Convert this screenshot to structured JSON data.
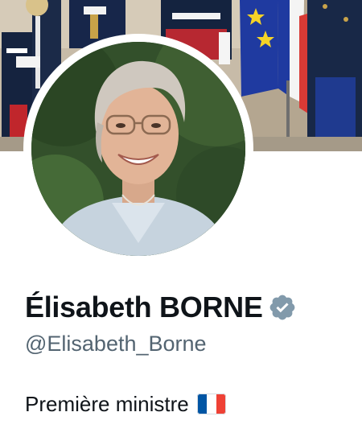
{
  "profile": {
    "display_name": "Élisabeth BORNE",
    "handle": "@Elisabeth_Borne",
    "bio": "Première ministre",
    "verified": true,
    "bio_emoji": "french-flag-icon"
  },
  "colors": {
    "name_text": "#0f1419",
    "handle_text": "#536471",
    "verified_badge": "#829aab",
    "flag_blue": "#0055a4",
    "flag_white": "#ffffff",
    "flag_red": "#ef4135"
  }
}
